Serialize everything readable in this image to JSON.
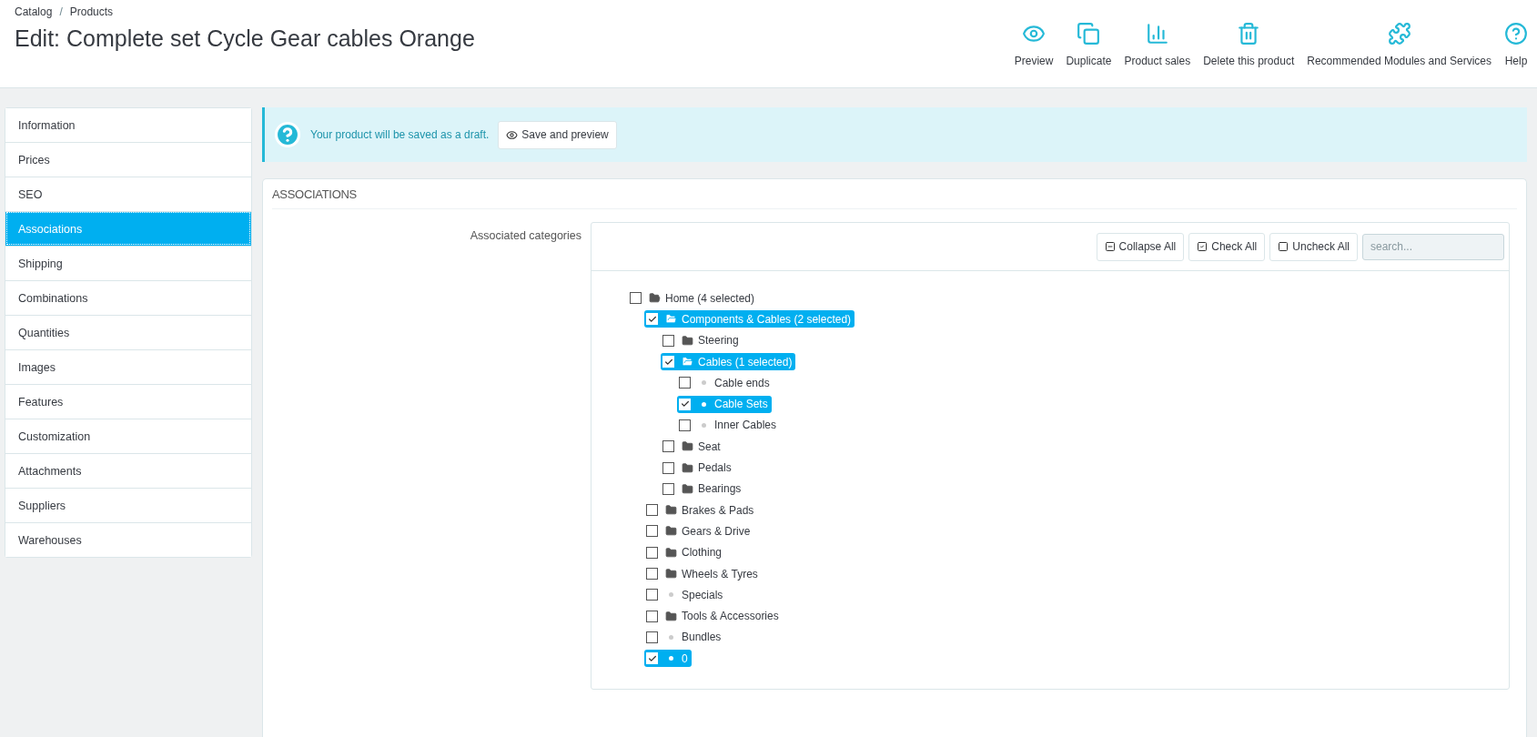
{
  "breadcrumb": [
    "Catalog",
    "Products"
  ],
  "breadcrumb_separator": "/",
  "page_title": "Edit: Complete set Cycle Gear cables Orange",
  "toolbar": [
    {
      "kind": "eye",
      "label": "Preview"
    },
    {
      "kind": "copy",
      "label": "Duplicate"
    },
    {
      "kind": "chart",
      "label": "Product sales"
    },
    {
      "kind": "trash",
      "label": "Delete this product"
    },
    {
      "kind": "puzzle",
      "label": "Recommended Modules and Services"
    },
    {
      "kind": "help",
      "label": "Help"
    }
  ],
  "sidebar": {
    "items": [
      {
        "label": "Information",
        "selected": false
      },
      {
        "label": "Prices",
        "selected": false
      },
      {
        "label": "SEO",
        "selected": false
      },
      {
        "label": "Associations",
        "selected": true
      },
      {
        "label": "Shipping",
        "selected": false
      },
      {
        "label": "Combinations",
        "selected": false
      },
      {
        "label": "Quantities",
        "selected": false
      },
      {
        "label": "Images",
        "selected": false
      },
      {
        "label": "Features",
        "selected": false
      },
      {
        "label": "Customization",
        "selected": false
      },
      {
        "label": "Attachments",
        "selected": false
      },
      {
        "label": "Suppliers",
        "selected": false
      },
      {
        "label": "Warehouses",
        "selected": false
      }
    ]
  },
  "alert": {
    "message": "Your product will be saved as a draft.",
    "button": "Save and preview"
  },
  "panel": {
    "title": "ASSOCIATIONS",
    "field_label": "Associated categories",
    "tree_buttons": [
      {
        "kind": "collapse",
        "label": "Collapse All"
      },
      {
        "kind": "check",
        "label": "Check All"
      },
      {
        "kind": "uncheck",
        "label": "Uncheck All"
      }
    ],
    "search": {
      "placeholder": "search..."
    },
    "tree": [
      {
        "kind": "folder",
        "label": "Home (4 selected)",
        "checked": false,
        "expanded": true,
        "children": [
          {
            "kind": "folder",
            "label": "Components & Cables (2 selected)",
            "checked": true,
            "expanded": true,
            "children": [
              {
                "kind": "folder",
                "label": "Steering",
                "checked": false,
                "expanded": false
              },
              {
                "kind": "folder",
                "label": "Cables (1 selected)",
                "checked": true,
                "expanded": true,
                "children": [
                  {
                    "kind": "leaf",
                    "label": "Cable ends",
                    "checked": false
                  },
                  {
                    "kind": "leaf",
                    "label": "Cable Sets",
                    "checked": true
                  },
                  {
                    "kind": "leaf",
                    "label": "Inner Cables",
                    "checked": false
                  }
                ]
              },
              {
                "kind": "folder",
                "label": "Seat",
                "checked": false,
                "expanded": false
              },
              {
                "kind": "folder",
                "label": "Pedals",
                "checked": false,
                "expanded": false
              },
              {
                "kind": "folder",
                "label": "Bearings",
                "checked": false,
                "expanded": false
              }
            ]
          },
          {
            "kind": "folder",
            "label": "Brakes & Pads",
            "checked": false,
            "expanded": false
          },
          {
            "kind": "folder",
            "label": "Gears & Drive",
            "checked": false,
            "expanded": false
          },
          {
            "kind": "folder",
            "label": "Clothing",
            "checked": false,
            "expanded": false
          },
          {
            "kind": "folder",
            "label": "Wheels & Tyres",
            "checked": false,
            "expanded": false
          },
          {
            "kind": "leaf",
            "label": "Specials",
            "checked": false
          },
          {
            "kind": "folder",
            "label": "Tools & Accessories",
            "checked": false,
            "expanded": false
          },
          {
            "kind": "leaf",
            "label": "Bundles",
            "checked": false
          },
          {
            "kind": "leaf",
            "label": "0",
            "checked": true
          }
        ]
      }
    ]
  }
}
